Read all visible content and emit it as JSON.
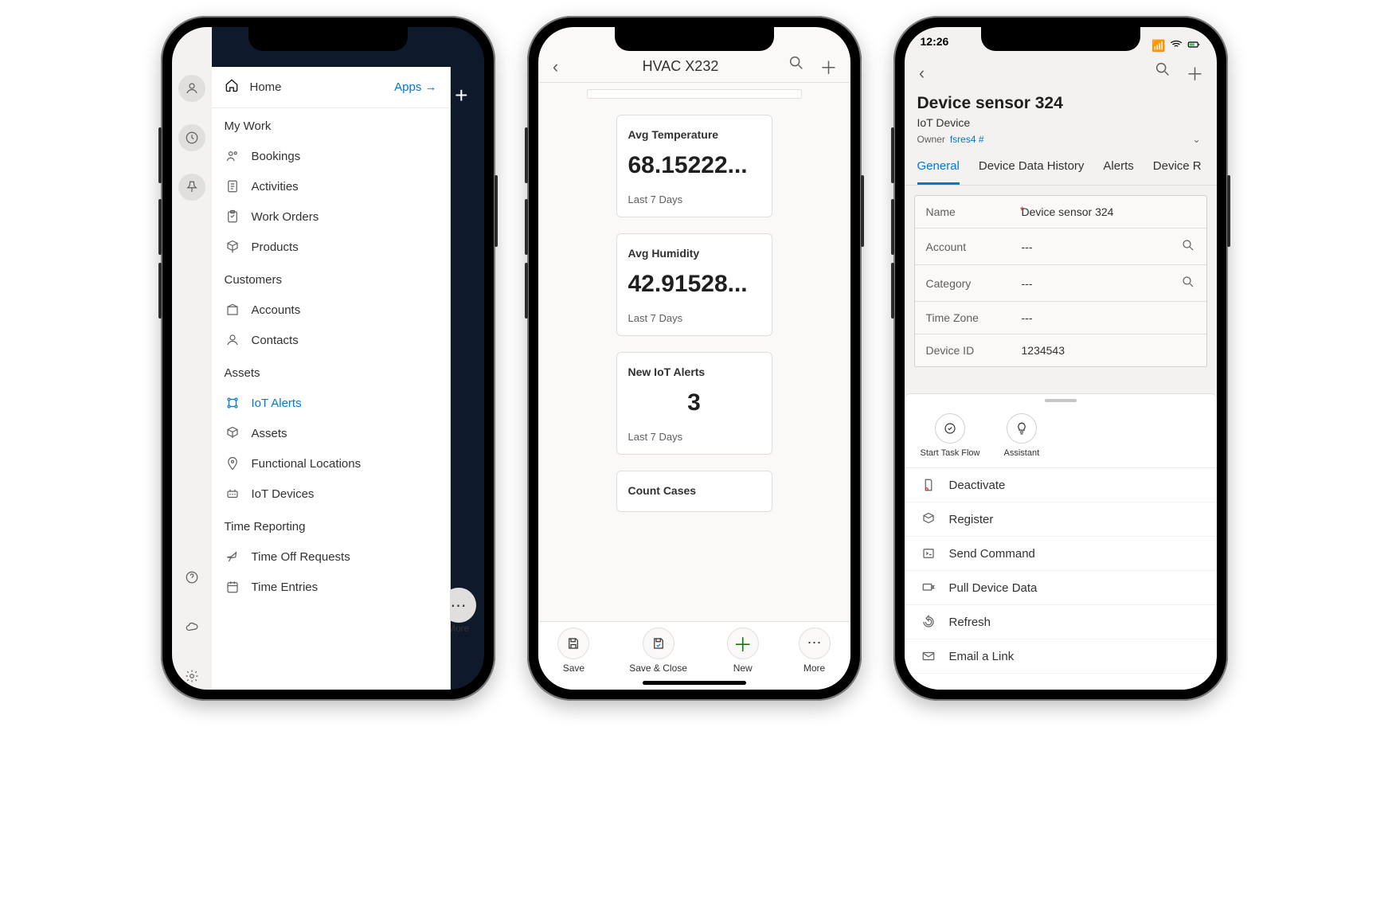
{
  "phone1": {
    "home_label": "Home",
    "apps_link": "Apps →",
    "header_plus": "+",
    "more_label": "More",
    "sections": {
      "mywork": {
        "header": "My Work",
        "items": [
          "Bookings",
          "Activities",
          "Work Orders",
          "Products"
        ]
      },
      "customers": {
        "header": "Customers",
        "items": [
          "Accounts",
          "Contacts"
        ]
      },
      "assets": {
        "header": "Assets",
        "items": [
          "IoT Alerts",
          "Assets",
          "Functional Locations",
          "IoT Devices"
        ],
        "active": "IoT Alerts"
      },
      "time": {
        "header": "Time Reporting",
        "items": [
          "Time Off Requests",
          "Time Entries"
        ]
      }
    }
  },
  "phone2": {
    "title": "HVAC X232",
    "cards": [
      {
        "title": "Avg Temperature",
        "value": "68.15222...",
        "sub": "Last 7 Days"
      },
      {
        "title": "Avg Humidity",
        "value": "42.91528...",
        "sub": "Last 7 Days"
      },
      {
        "title": "New IoT Alerts",
        "value": "3",
        "sub": "Last 7 Days",
        "center": true
      },
      {
        "title": "Count Cases",
        "value": "",
        "sub": ""
      }
    ],
    "tabs": {
      "save": "Save",
      "saveclose": "Save & Close",
      "new": "New",
      "more": "More"
    }
  },
  "phone3": {
    "clock": "12:26",
    "title": "Device sensor 324",
    "subtitle": "IoT Device",
    "owner_lbl": "Owner",
    "owner_val": "fsres4 #",
    "tabs": [
      "General",
      "Device Data History",
      "Alerts",
      "Device R"
    ],
    "fields": {
      "name": {
        "label": "Name",
        "value": "Device sensor 324",
        "required": true
      },
      "account": {
        "label": "Account",
        "value": "---",
        "lookup": true
      },
      "category": {
        "label": "Category",
        "value": "---",
        "lookup": true
      },
      "tz": {
        "label": "Time Zone",
        "value": "---"
      },
      "devid": {
        "label": "Device ID",
        "value": "1234543"
      }
    },
    "quick": {
      "taskflow": "Start Task Flow",
      "assistant": "Assistant"
    },
    "menu": [
      "Deactivate",
      "Register",
      "Send Command",
      "Pull Device Data",
      "Refresh",
      "Email a Link"
    ]
  }
}
